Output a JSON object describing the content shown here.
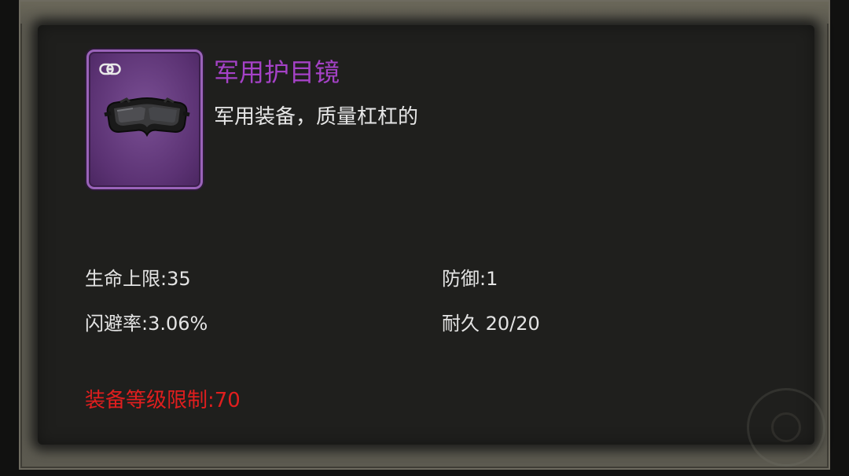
{
  "item": {
    "name": "军用护目镜",
    "description": "军用装备，质量杠杠的",
    "icon": "military-goggles-icon",
    "bind_icon": "chain-link-icon",
    "rarity_color": "#a542c7"
  },
  "stats": {
    "max_hp": "生命上限:35",
    "defense": "防御:1",
    "dodge": "闪避率:3.06%",
    "durability": "耐久 20/20"
  },
  "requirement": {
    "label": "装备等级限制:70",
    "color": "#e01e1e"
  }
}
